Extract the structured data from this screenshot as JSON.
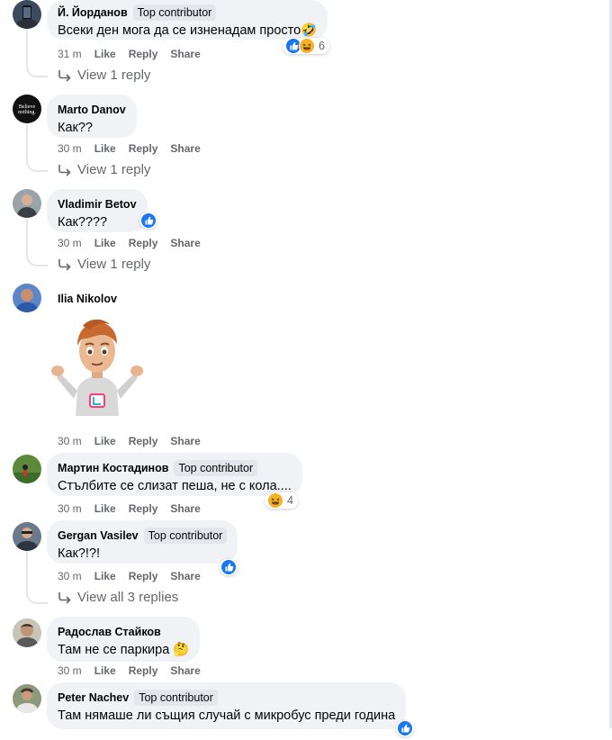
{
  "actions": {
    "like": "Like",
    "reply": "Reply",
    "share": "Share"
  },
  "colors": {
    "bubble": "#f0f2f5",
    "badge": "#e4e6eb",
    "meta": "#65676b",
    "like_blue": "#1877f2",
    "haha_yellow": "#f7b125"
  },
  "comments": [
    {
      "id": "c1",
      "author": "Й. Йорданов",
      "badge": "Top contributor",
      "text": "Всеки ден мога да се изненадам просто🤣",
      "time": "31 m",
      "reactions": [
        "like-icon",
        "haha-icon"
      ],
      "reaction_count": "6",
      "reply_link": "View 1 reply"
    },
    {
      "id": "c2",
      "author": "Marto Danov",
      "badge": "",
      "text": "Как??",
      "time": "30 m",
      "reply_link": "View 1 reply"
    },
    {
      "id": "c3",
      "author": "Vladimir Betov",
      "badge": "",
      "text": "Как????",
      "time": "30 m",
      "reactions": [
        "like-icon"
      ],
      "reply_link": "View 1 reply"
    },
    {
      "id": "c4",
      "author": "Ilia Nikolov",
      "badge": "",
      "text": "",
      "time": "30 m",
      "sticker": "shrugging-avatar-sticker"
    },
    {
      "id": "c5",
      "author": "Мартин Костадинов",
      "badge": "Top contributor",
      "text": "Стълбите се слизат пеша, не с кола....",
      "time": "30 m",
      "reactions": [
        "haha-icon"
      ],
      "reaction_count": "4"
    },
    {
      "id": "c6",
      "author": "Gergan Vasilev",
      "badge": "Top contributor",
      "text": "Как?!?!",
      "time": "30 m",
      "reactions": [
        "like-icon"
      ],
      "reply_link": "View all 3 replies"
    },
    {
      "id": "c7",
      "author": "Радослав Стайков",
      "badge": "",
      "text": "Там не се паркира 🤔",
      "time": "30 m"
    },
    {
      "id": "c8",
      "author": "Peter Nachev",
      "badge": "Top contributor",
      "text": "Там нямаше ли същия случай с микробус преди година",
      "time": "",
      "reactions": [
        "like-icon"
      ]
    }
  ]
}
